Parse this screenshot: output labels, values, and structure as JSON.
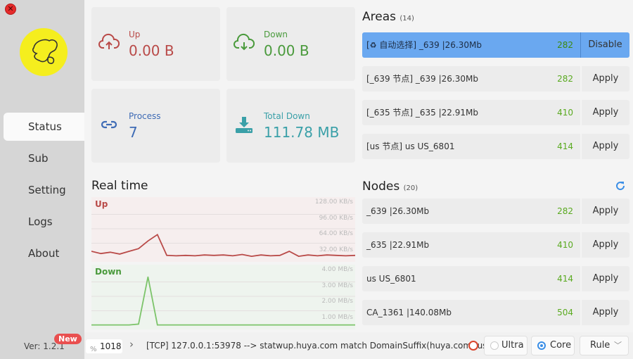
{
  "sidebar": {
    "nav": [
      "Status",
      "Sub",
      "Setting",
      "Logs",
      "About"
    ],
    "version": "Ver: 1.2.1",
    "new_badge": "New"
  },
  "stats": {
    "up": {
      "label": "Up",
      "value": "0.00 B"
    },
    "down": {
      "label": "Down",
      "value": "0.00 B"
    },
    "process": {
      "label": "Process",
      "value": "7"
    },
    "total_down": {
      "label": "Total Down",
      "value": "111.78 MB"
    }
  },
  "realtime": {
    "title": "Real time",
    "up_label": "Up",
    "down_label": "Down",
    "up_ticks": [
      "128.00 KB/s",
      "96.00 KB/s",
      "64.00 KB/s",
      "32.00 KB/s"
    ],
    "down_ticks": [
      "4.00 MB/s",
      "3.00 MB/s",
      "2.00 MB/s",
      "1.00 MB/s"
    ]
  },
  "chart_data": [
    {
      "type": "line",
      "title": "Up",
      "ylim": [
        0,
        128
      ],
      "unit": "KB/s",
      "values": [
        14,
        9,
        12,
        8,
        14,
        20,
        37,
        51,
        5,
        4,
        5,
        4,
        6,
        5,
        6,
        4,
        7,
        3,
        6,
        4,
        5,
        14,
        3,
        6,
        4,
        6,
        5,
        4,
        5
      ]
    },
    {
      "type": "line",
      "title": "Down",
      "ylim": [
        0,
        4
      ],
      "unit": "MB/s",
      "values": [
        0.02,
        0.02,
        0.02,
        0.02,
        0.02,
        0.08,
        3.35,
        0.02,
        0.02,
        0.02,
        0.02,
        0.02,
        0.02,
        0.02,
        0.02,
        0.02,
        0.02,
        0.02,
        0.02,
        0.02,
        0.02,
        0.02,
        0.02,
        0.02,
        0.02,
        0.02,
        0.02,
        0.02,
        0.02
      ]
    }
  ],
  "areas": {
    "title": "Areas",
    "count": "(14)",
    "items": [
      {
        "name": "自动选择] _639 |26.30Mb",
        "latency": "282",
        "action": "Disable",
        "prefix": "["
      },
      {
        "name": "[_639 节点] _639 |26.30Mb",
        "latency": "282",
        "action": "Apply"
      },
      {
        "name": "[_635 节点] _635 |22.91Mb",
        "latency": "410",
        "action": "Apply"
      },
      {
        "name": "[us 节点] us US_6801",
        "latency": "414",
        "action": "Apply"
      }
    ]
  },
  "nodes": {
    "title": "Nodes",
    "count": "(20)",
    "items": [
      {
        "name": "_639 |26.30Mb",
        "latency": "282",
        "action": "Apply"
      },
      {
        "name": "_635 |22.91Mb",
        "latency": "410",
        "action": "Apply"
      },
      {
        "name": "us US_6801",
        "latency": "414",
        "action": "Apply"
      },
      {
        "name": "CA_1361 |140.08Mb",
        "latency": "504",
        "action": "Apply"
      }
    ]
  },
  "bottom": {
    "connections": "1018",
    "log": "[TCP] 127.0.0.1:53978 --> statwup.huya.com match DomainSuffix(huya.com) using",
    "ultra": "Ultra",
    "core": "Core",
    "rule": "Rule"
  },
  "colors": {
    "up": "#b94a48",
    "down": "#4a9a3c",
    "selected_row": "#6aa8f0",
    "latency": "#5aaa20"
  }
}
